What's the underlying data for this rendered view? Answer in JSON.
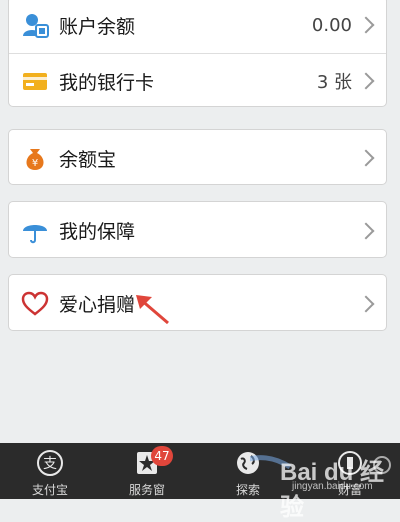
{
  "list": {
    "account_balance": {
      "label": "账户余额",
      "value": "0.00",
      "icon": "user-balance-icon"
    },
    "bank_cards": {
      "label": "我的银行卡",
      "value": "3 张",
      "icon": "bank-card-icon"
    },
    "yuebao": {
      "label": "余额宝",
      "icon": "money-bag-icon"
    },
    "insurance": {
      "label": "我的保障",
      "icon": "umbrella-icon"
    },
    "donation": {
      "label": "爱心捐赠",
      "icon": "heart-icon"
    }
  },
  "tabbar": {
    "tabs": [
      {
        "label": "支付宝",
        "icon": "alipay-icon",
        "glyph": "支"
      },
      {
        "label": "服务窗",
        "icon": "star-window-icon",
        "badge": "47"
      },
      {
        "label": "探索",
        "icon": "globe-icon"
      },
      {
        "label": "财富",
        "icon": "wealth-icon"
      }
    ]
  },
  "watermark": {
    "brand": "Bai du 经验",
    "url": "jingyan.baidu.com"
  },
  "colors": {
    "accent_red": "#e0463b",
    "tabbar_bg": "#2b2b2b",
    "page_bg": "#eceeef",
    "icon_blue": "#3a8fd8",
    "icon_yellow": "#f2b01e",
    "icon_orange": "#e7781c",
    "heart_red": "#cc3333"
  }
}
